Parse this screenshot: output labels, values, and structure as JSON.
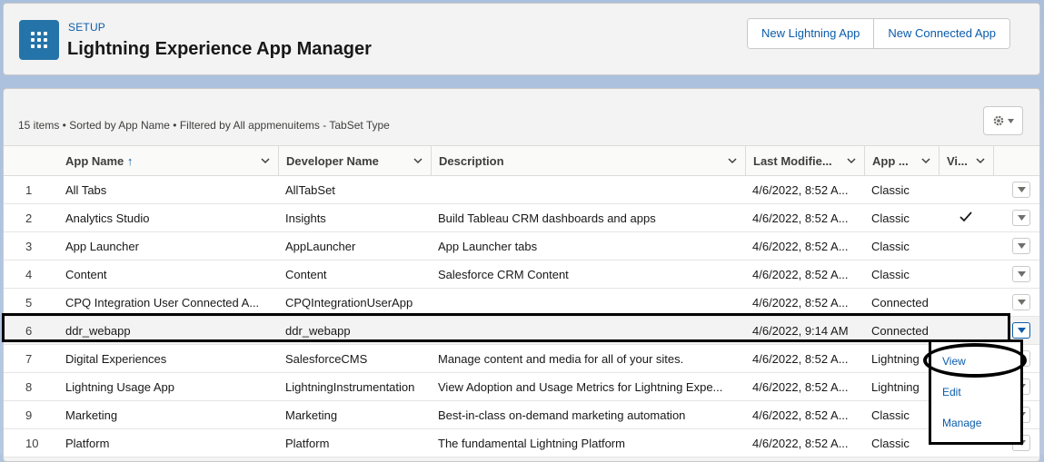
{
  "header": {
    "setup_label": "SETUP",
    "title": "Lightning Experience App Manager",
    "buttons": {
      "new_lightning_app": "New Lightning App",
      "new_connected_app": "New Connected App"
    },
    "icon": "app-grid-icon"
  },
  "list": {
    "info": "15 items • Sorted by App Name • Filtered by All appmenuitems - TabSet Type",
    "columns": {
      "app_name": "App Name",
      "developer_name": "Developer Name",
      "description": "Description",
      "last_modified": "Last Modifie...",
      "app_type": "App ...",
      "visible": "Vi..."
    },
    "rows": [
      {
        "num": "1",
        "app_name": "All Tabs",
        "developer_name": "AllTabSet",
        "description": "",
        "last_modified": "4/6/2022, 8:52 A...",
        "app_type": "Classic",
        "visible": false
      },
      {
        "num": "2",
        "app_name": "Analytics Studio",
        "developer_name": "Insights",
        "description": "Build Tableau CRM dashboards and apps",
        "last_modified": "4/6/2022, 8:52 A...",
        "app_type": "Classic",
        "visible": true
      },
      {
        "num": "3",
        "app_name": "App Launcher",
        "developer_name": "AppLauncher",
        "description": "App Launcher tabs",
        "last_modified": "4/6/2022, 8:52 A...",
        "app_type": "Classic",
        "visible": false
      },
      {
        "num": "4",
        "app_name": "Content",
        "developer_name": "Content",
        "description": "Salesforce CRM Content",
        "last_modified": "4/6/2022, 8:52 A...",
        "app_type": "Classic",
        "visible": false
      },
      {
        "num": "5",
        "app_name": "CPQ Integration User Connected A...",
        "developer_name": "CPQIntegrationUserApp",
        "description": "",
        "last_modified": "4/6/2022, 8:52 A...",
        "app_type": "Connected",
        "visible": false
      },
      {
        "num": "6",
        "app_name": "ddr_webapp",
        "developer_name": "ddr_webapp",
        "description": "",
        "last_modified": "4/6/2022, 9:14 AM",
        "app_type": "Connected",
        "visible": false
      },
      {
        "num": "7",
        "app_name": "Digital Experiences",
        "developer_name": "SalesforceCMS",
        "description": "Manage content and media for all of your sites.",
        "last_modified": "4/6/2022, 8:52 A...",
        "app_type": "Lightning",
        "visible": false
      },
      {
        "num": "8",
        "app_name": "Lightning Usage App",
        "developer_name": "LightningInstrumentation",
        "description": "View Adoption and Usage Metrics for Lightning Expe...",
        "last_modified": "4/6/2022, 8:52 A...",
        "app_type": "Lightning",
        "visible": false
      },
      {
        "num": "9",
        "app_name": "Marketing",
        "developer_name": "Marketing",
        "description": "Best-in-class on-demand marketing automation",
        "last_modified": "4/6/2022, 8:52 A...",
        "app_type": "Classic",
        "visible": false
      },
      {
        "num": "10",
        "app_name": "Platform",
        "developer_name": "Platform",
        "description": "The fundamental Lightning Platform",
        "last_modified": "4/6/2022, 8:52 A...",
        "app_type": "Classic",
        "visible": false
      }
    ]
  },
  "menu": {
    "view": "View",
    "edit": "Edit",
    "manage": "Manage"
  },
  "colors": {
    "brand": "#2574a9",
    "link": "#0b5cab"
  }
}
